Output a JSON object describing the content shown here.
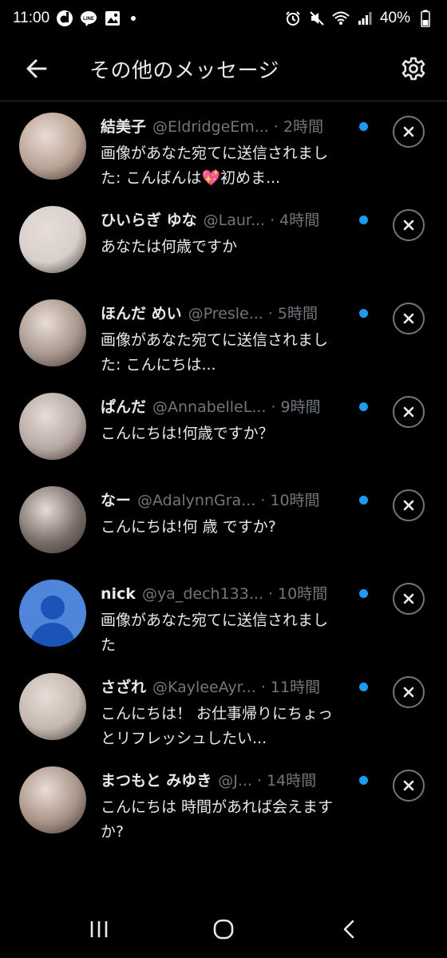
{
  "status_bar": {
    "time": "11:00",
    "battery": "40%",
    "left_icons": [
      "d-app-icon",
      "line-icon",
      "gallery-icon"
    ],
    "right_icons": [
      "alarm-icon",
      "mute-icon",
      "wifi-icon",
      "signal-icon"
    ]
  },
  "header": {
    "title": "その他のメッセージ",
    "back_icon": "arrow-left-icon",
    "settings_icon": "gear-icon"
  },
  "messages": [
    {
      "name": "結美子",
      "handle": "@EldridgeEm...",
      "time": "· 2時間",
      "preview": "画像があなた宛てに送信されました: こんばんは💖初めま...",
      "avatar_color": "#b9a294",
      "unread": true
    },
    {
      "name": "ひいらぎ ゆな",
      "handle": "@Laur...",
      "time": "· 4時間",
      "preview": "あなたは何歳ですか",
      "avatar_color": "#d8cfcb",
      "unread": true
    },
    {
      "name": "ほんだ めい",
      "handle": "@Presle...",
      "time": "· 5時間",
      "preview": "画像があなた宛てに送信されました: こんにちは...",
      "avatar_color": "#a7968d",
      "unread": true
    },
    {
      "name": "ぱんだ",
      "handle": "@AnnabelleL...",
      "time": "· 9時間",
      "preview": "こんにちは!何歳ですか？",
      "avatar_color": "#b7a8a3",
      "unread": true
    },
    {
      "name": "なー",
      "handle": "@AdalynnGra...",
      "time": "· 10時間",
      "preview": "こんにちは!何 歳 ですか?",
      "avatar_color": "#7a6e6a",
      "unread": true
    },
    {
      "name": "nick",
      "handle": "@ya_dech133...",
      "time": "· 10時間",
      "preview": "画像があなた宛てに送信されました",
      "avatar_color": "#4f86d9",
      "avatar_default": true,
      "unread": true
    },
    {
      "name": "さざれ",
      "handle": "@KayleeAyr...",
      "time": "· 11時間",
      "preview": "こんにちは！ お仕事帰りにちょっとリフレッシュしたい...",
      "avatar_color": "#c4b7b0",
      "unread": true
    },
    {
      "name": "まつもと みゆき",
      "handle": "@J...",
      "time": "· 14時間",
      "preview": "こんにちは 時間があれば会えますか?",
      "avatar_color": "#a99388",
      "unread": true
    }
  ],
  "colors": {
    "background": "#000000",
    "text_primary": "#e7e9ea",
    "text_secondary": "#71767b",
    "accent": "#1d9bf0",
    "divider": "#2f3336"
  },
  "nav_bar": {
    "icons": [
      "recent-apps-icon",
      "home-icon",
      "back-icon"
    ]
  }
}
